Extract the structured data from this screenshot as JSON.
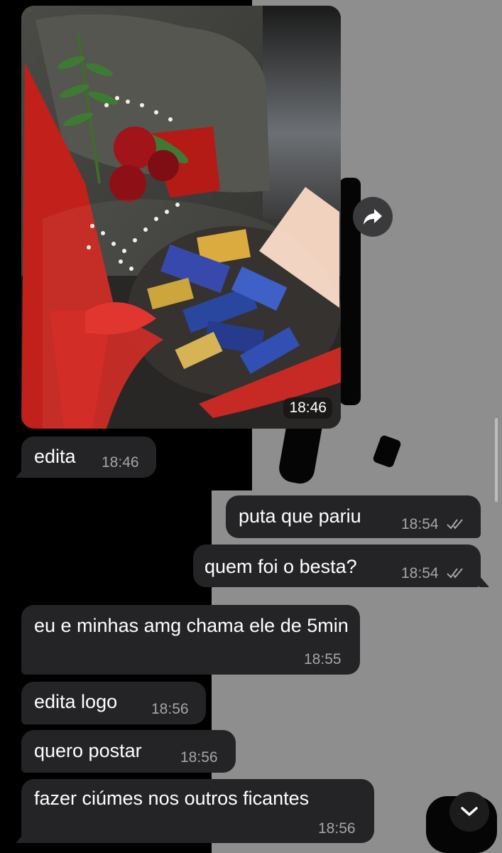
{
  "photo_message": {
    "time": "18:46"
  },
  "messages": [
    {
      "text": "edita",
      "time": "18:46",
      "dir": "in"
    },
    {
      "text": "puta que pariu",
      "time": "18:54",
      "dir": "out"
    },
    {
      "text": "quem foi o besta?",
      "time": "18:54",
      "dir": "out"
    },
    {
      "text": "eu e minhas amg chama ele de 5min",
      "time": "18:55",
      "dir": "in"
    },
    {
      "text": "edita logo",
      "time": "18:56",
      "dir": "in"
    },
    {
      "text": "quero postar",
      "time": "18:56",
      "dir": "in"
    },
    {
      "text": "fazer ciúmes nos outros ficantes",
      "time": "18:56",
      "dir": "in"
    }
  ],
  "icons": {
    "forward": "forward-icon",
    "scroll_down": "chevron-down-icon",
    "read": "double-check-icon"
  },
  "colors": {
    "bubble": "#242426",
    "time": "#a5a5a8",
    "wallpaper_grey": "#8e8e8e"
  }
}
